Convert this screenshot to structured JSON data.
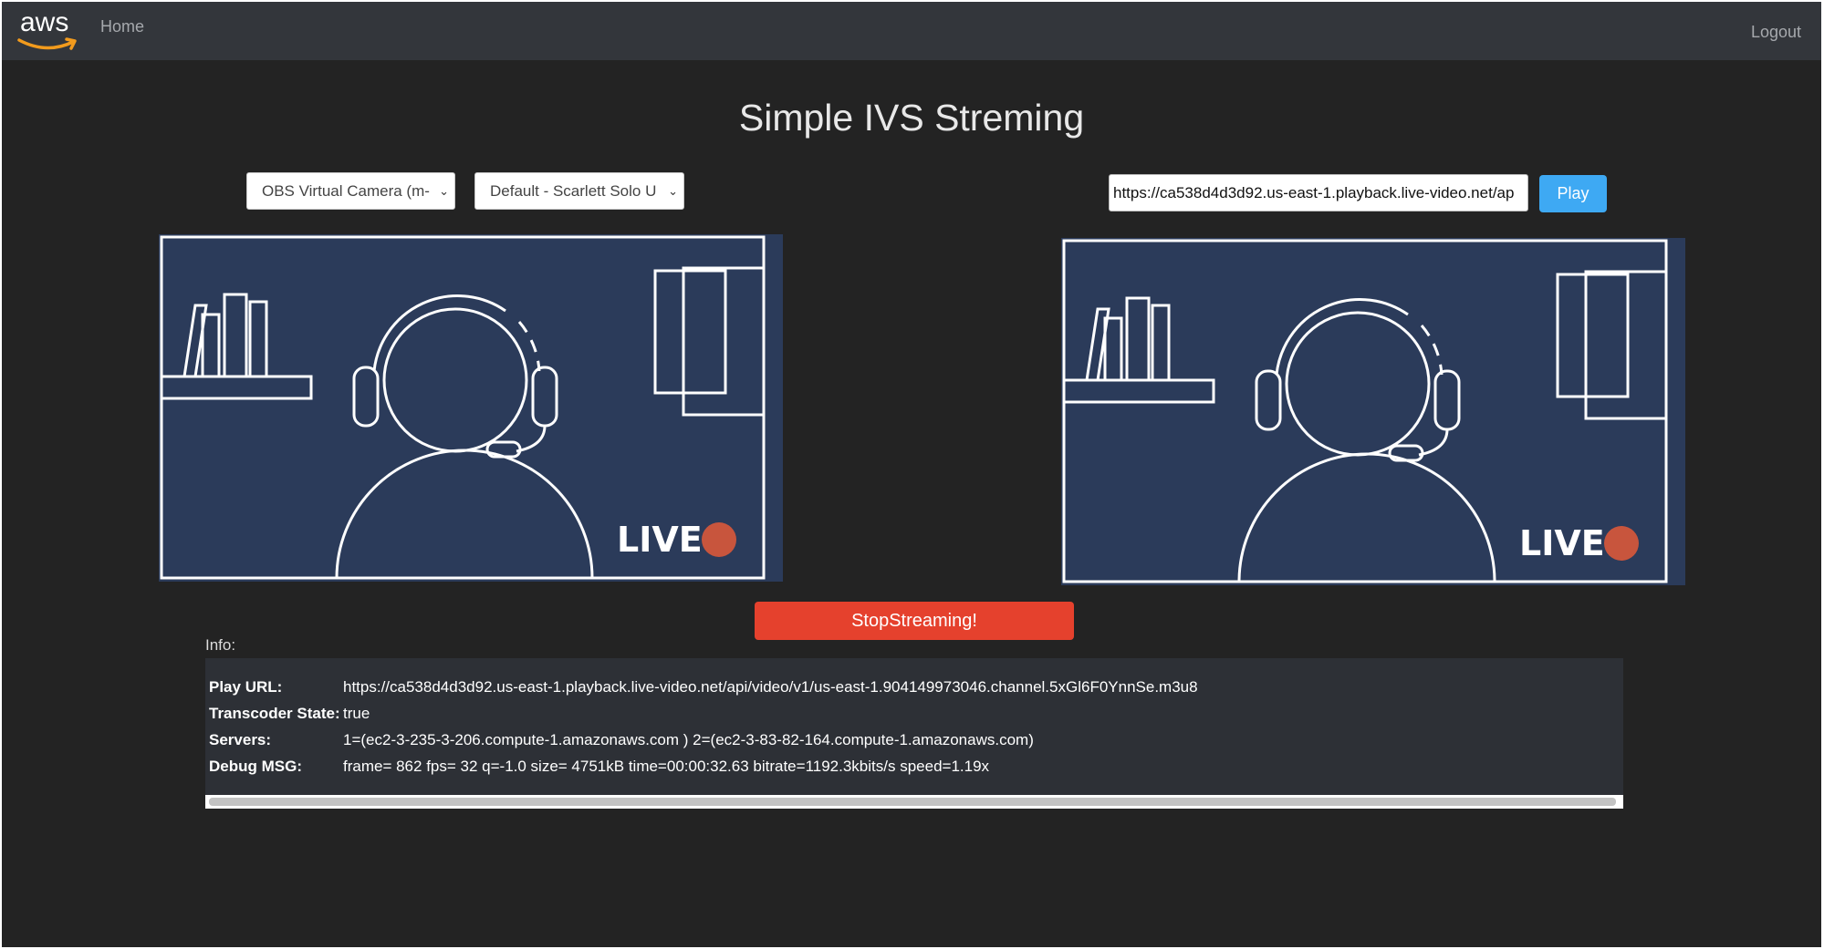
{
  "nav": {
    "logo_text": "aws",
    "home_label": "Home",
    "logout_label": "Logout"
  },
  "page": {
    "title": "Simple IVS Streming"
  },
  "devices": {
    "camera_select": "OBS Virtual Camera (m-",
    "audio_select": "Default - Scarlett Solo U"
  },
  "player": {
    "url_value": "https://ca538d4d3d92.us-east-1.playback.live-video.net/ap",
    "play_label": "Play"
  },
  "video": {
    "live_badge": "LIVE",
    "background_color": "#2b3b5a",
    "live_dot_color": "#c8553d"
  },
  "controls": {
    "stop_label": "StopStreaming!",
    "stop_color": "#e5412d"
  },
  "info": {
    "label": "Info:",
    "rows": [
      {
        "key": "Play URL:",
        "value": "https://ca538d4d3d92.us-east-1.playback.live-video.net/api/video/v1/us-east-1.904149973046.channel.5xGl6F0YnnSe.m3u8"
      },
      {
        "key": "Transcoder State:",
        "value": "true"
      },
      {
        "key": "Servers:",
        "value": "1=(ec2-3-235-3-206.compute-1.amazonaws.com ) 2=(ec2-3-83-82-164.compute-1.amazonaws.com)"
      },
      {
        "key": "Debug MSG:",
        "value": "frame= 862 fps= 32 q=-1.0 size= 4751kB time=00:00:32.63 bitrate=1192.3kbits/s speed=1.19x"
      }
    ]
  }
}
